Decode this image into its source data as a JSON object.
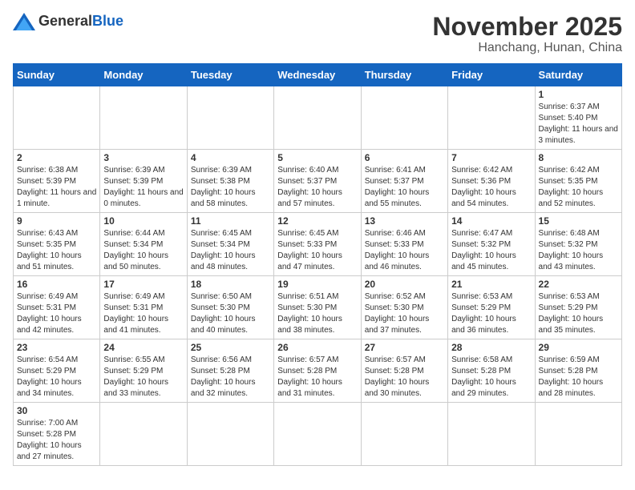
{
  "header": {
    "logo_general": "General",
    "logo_blue": "Blue",
    "month_title": "November 2025",
    "location": "Hanchang, Hunan, China"
  },
  "days_of_week": [
    "Sunday",
    "Monday",
    "Tuesday",
    "Wednesday",
    "Thursday",
    "Friday",
    "Saturday"
  ],
  "weeks": [
    [
      {
        "day": "",
        "info": ""
      },
      {
        "day": "",
        "info": ""
      },
      {
        "day": "",
        "info": ""
      },
      {
        "day": "",
        "info": ""
      },
      {
        "day": "",
        "info": ""
      },
      {
        "day": "",
        "info": ""
      },
      {
        "day": "1",
        "info": "Sunrise: 6:37 AM\nSunset: 5:40 PM\nDaylight: 11 hours and 3 minutes."
      }
    ],
    [
      {
        "day": "2",
        "info": "Sunrise: 6:38 AM\nSunset: 5:39 PM\nDaylight: 11 hours and 1 minute."
      },
      {
        "day": "3",
        "info": "Sunrise: 6:39 AM\nSunset: 5:39 PM\nDaylight: 11 hours and 0 minutes."
      },
      {
        "day": "4",
        "info": "Sunrise: 6:39 AM\nSunset: 5:38 PM\nDaylight: 10 hours and 58 minutes."
      },
      {
        "day": "5",
        "info": "Sunrise: 6:40 AM\nSunset: 5:37 PM\nDaylight: 10 hours and 57 minutes."
      },
      {
        "day": "6",
        "info": "Sunrise: 6:41 AM\nSunset: 5:37 PM\nDaylight: 10 hours and 55 minutes."
      },
      {
        "day": "7",
        "info": "Sunrise: 6:42 AM\nSunset: 5:36 PM\nDaylight: 10 hours and 54 minutes."
      },
      {
        "day": "8",
        "info": "Sunrise: 6:42 AM\nSunset: 5:35 PM\nDaylight: 10 hours and 52 minutes."
      }
    ],
    [
      {
        "day": "9",
        "info": "Sunrise: 6:43 AM\nSunset: 5:35 PM\nDaylight: 10 hours and 51 minutes."
      },
      {
        "day": "10",
        "info": "Sunrise: 6:44 AM\nSunset: 5:34 PM\nDaylight: 10 hours and 50 minutes."
      },
      {
        "day": "11",
        "info": "Sunrise: 6:45 AM\nSunset: 5:34 PM\nDaylight: 10 hours and 48 minutes."
      },
      {
        "day": "12",
        "info": "Sunrise: 6:45 AM\nSunset: 5:33 PM\nDaylight: 10 hours and 47 minutes."
      },
      {
        "day": "13",
        "info": "Sunrise: 6:46 AM\nSunset: 5:33 PM\nDaylight: 10 hours and 46 minutes."
      },
      {
        "day": "14",
        "info": "Sunrise: 6:47 AM\nSunset: 5:32 PM\nDaylight: 10 hours and 45 minutes."
      },
      {
        "day": "15",
        "info": "Sunrise: 6:48 AM\nSunset: 5:32 PM\nDaylight: 10 hours and 43 minutes."
      }
    ],
    [
      {
        "day": "16",
        "info": "Sunrise: 6:49 AM\nSunset: 5:31 PM\nDaylight: 10 hours and 42 minutes."
      },
      {
        "day": "17",
        "info": "Sunrise: 6:49 AM\nSunset: 5:31 PM\nDaylight: 10 hours and 41 minutes."
      },
      {
        "day": "18",
        "info": "Sunrise: 6:50 AM\nSunset: 5:30 PM\nDaylight: 10 hours and 40 minutes."
      },
      {
        "day": "19",
        "info": "Sunrise: 6:51 AM\nSunset: 5:30 PM\nDaylight: 10 hours and 38 minutes."
      },
      {
        "day": "20",
        "info": "Sunrise: 6:52 AM\nSunset: 5:30 PM\nDaylight: 10 hours and 37 minutes."
      },
      {
        "day": "21",
        "info": "Sunrise: 6:53 AM\nSunset: 5:29 PM\nDaylight: 10 hours and 36 minutes."
      },
      {
        "day": "22",
        "info": "Sunrise: 6:53 AM\nSunset: 5:29 PM\nDaylight: 10 hours and 35 minutes."
      }
    ],
    [
      {
        "day": "23",
        "info": "Sunrise: 6:54 AM\nSunset: 5:29 PM\nDaylight: 10 hours and 34 minutes."
      },
      {
        "day": "24",
        "info": "Sunrise: 6:55 AM\nSunset: 5:29 PM\nDaylight: 10 hours and 33 minutes."
      },
      {
        "day": "25",
        "info": "Sunrise: 6:56 AM\nSunset: 5:28 PM\nDaylight: 10 hours and 32 minutes."
      },
      {
        "day": "26",
        "info": "Sunrise: 6:57 AM\nSunset: 5:28 PM\nDaylight: 10 hours and 31 minutes."
      },
      {
        "day": "27",
        "info": "Sunrise: 6:57 AM\nSunset: 5:28 PM\nDaylight: 10 hours and 30 minutes."
      },
      {
        "day": "28",
        "info": "Sunrise: 6:58 AM\nSunset: 5:28 PM\nDaylight: 10 hours and 29 minutes."
      },
      {
        "day": "29",
        "info": "Sunrise: 6:59 AM\nSunset: 5:28 PM\nDaylight: 10 hours and 28 minutes."
      }
    ],
    [
      {
        "day": "30",
        "info": "Sunrise: 7:00 AM\nSunset: 5:28 PM\nDaylight: 10 hours and 27 minutes."
      },
      {
        "day": "",
        "info": ""
      },
      {
        "day": "",
        "info": ""
      },
      {
        "day": "",
        "info": ""
      },
      {
        "day": "",
        "info": ""
      },
      {
        "day": "",
        "info": ""
      },
      {
        "day": "",
        "info": ""
      }
    ]
  ]
}
